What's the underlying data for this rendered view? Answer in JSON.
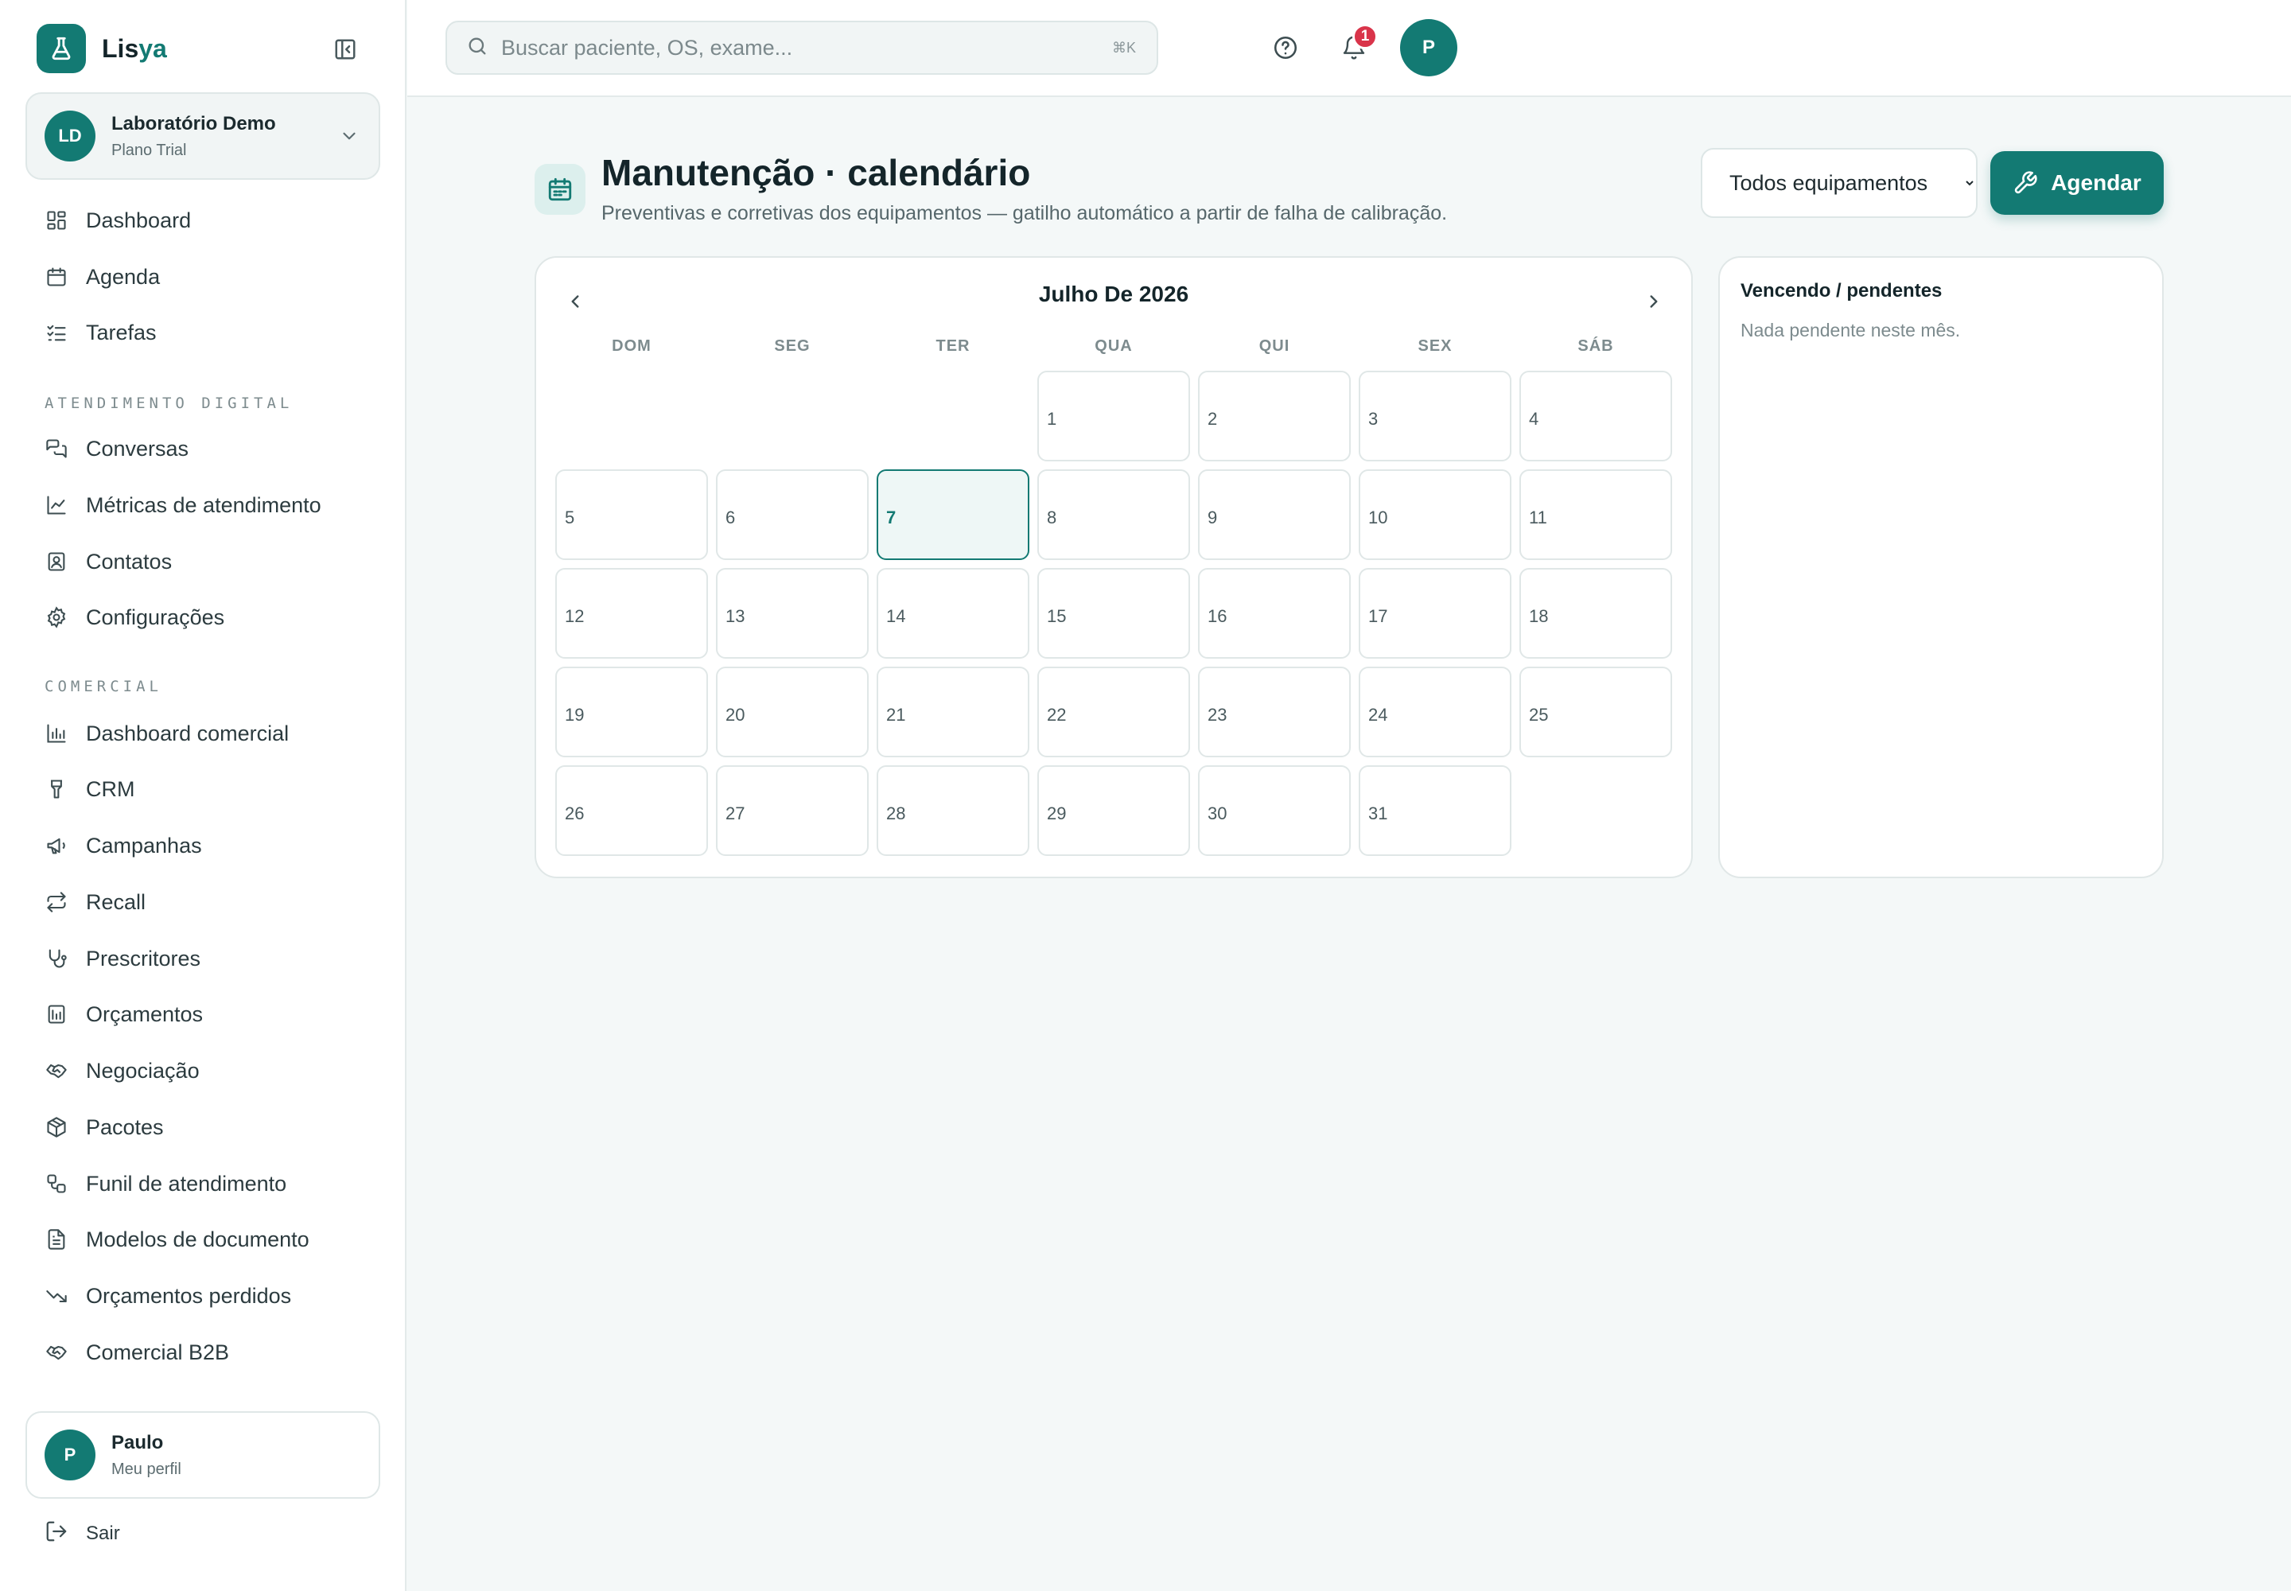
{
  "brand": {
    "name_prefix": "Lis",
    "name_suffix": "ya"
  },
  "org": {
    "initials": "LD",
    "name": "Laboratório Demo",
    "plan": "Plano Trial"
  },
  "nav": {
    "top_items": [
      {
        "label": "Dashboard",
        "icon": "layout-grid-icon"
      },
      {
        "label": "Agenda",
        "icon": "calendar-icon"
      },
      {
        "label": "Tarefas",
        "icon": "list-checks-icon"
      }
    ],
    "section_digital": "ATENDIMENTO DIGITAL",
    "digital_items": [
      {
        "label": "Conversas",
        "icon": "messages-icon"
      },
      {
        "label": "Métricas de atendimento",
        "icon": "line-chart-icon"
      },
      {
        "label": "Contatos",
        "icon": "contact-icon"
      },
      {
        "label": "Configurações",
        "icon": "gear-icon"
      }
    ],
    "section_comercial": "COMERCIAL",
    "comercial_items": [
      {
        "label": "Dashboard comercial",
        "icon": "bar-chart-icon"
      },
      {
        "label": "CRM",
        "icon": "funnel-icon"
      },
      {
        "label": "Campanhas",
        "icon": "megaphone-icon"
      },
      {
        "label": "Recall",
        "icon": "repeat-icon"
      },
      {
        "label": "Prescritores",
        "icon": "stethoscope-icon"
      },
      {
        "label": "Orçamentos",
        "icon": "receipt-icon"
      },
      {
        "label": "Negociação",
        "icon": "handshake-icon"
      },
      {
        "label": "Pacotes",
        "icon": "package-icon"
      },
      {
        "label": "Funil de atendimento",
        "icon": "workflow-icon"
      },
      {
        "label": "Modelos de documento",
        "icon": "file-text-icon"
      },
      {
        "label": "Orçamentos perdidos",
        "icon": "trending-down-icon"
      },
      {
        "label": "Comercial B2B",
        "icon": "handshake-icon"
      }
    ]
  },
  "profile": {
    "initial": "P",
    "name": "Paulo",
    "sub": "Meu perfil"
  },
  "logout_label": "Sair",
  "search": {
    "placeholder": "Buscar paciente, OS, exame...",
    "shortcut": "⌘K"
  },
  "topbar": {
    "notification_count": "1",
    "avatar_initial": "P"
  },
  "page": {
    "title": "Manutenção · calendário",
    "subtitle": "Preventivas e corretivas dos equipamentos — gatilho automático a partir de falha de calibração."
  },
  "filter": {
    "selected": "Todos equipamentos"
  },
  "agendar_label": "Agendar",
  "calendar": {
    "month_label": "Julho De 2026",
    "weekdays": [
      "DOM",
      "SEG",
      "TER",
      "QUA",
      "QUI",
      "SEX",
      "SÁB"
    ],
    "first_weekday_index": 3,
    "days_in_month": 31,
    "today": 7
  },
  "pending": {
    "title": "Vencendo / pendentes",
    "empty": "Nada pendente neste mês."
  },
  "colors": {
    "accent": "#137a73",
    "badge": "#d9344a",
    "background": "#f4f8f8"
  }
}
